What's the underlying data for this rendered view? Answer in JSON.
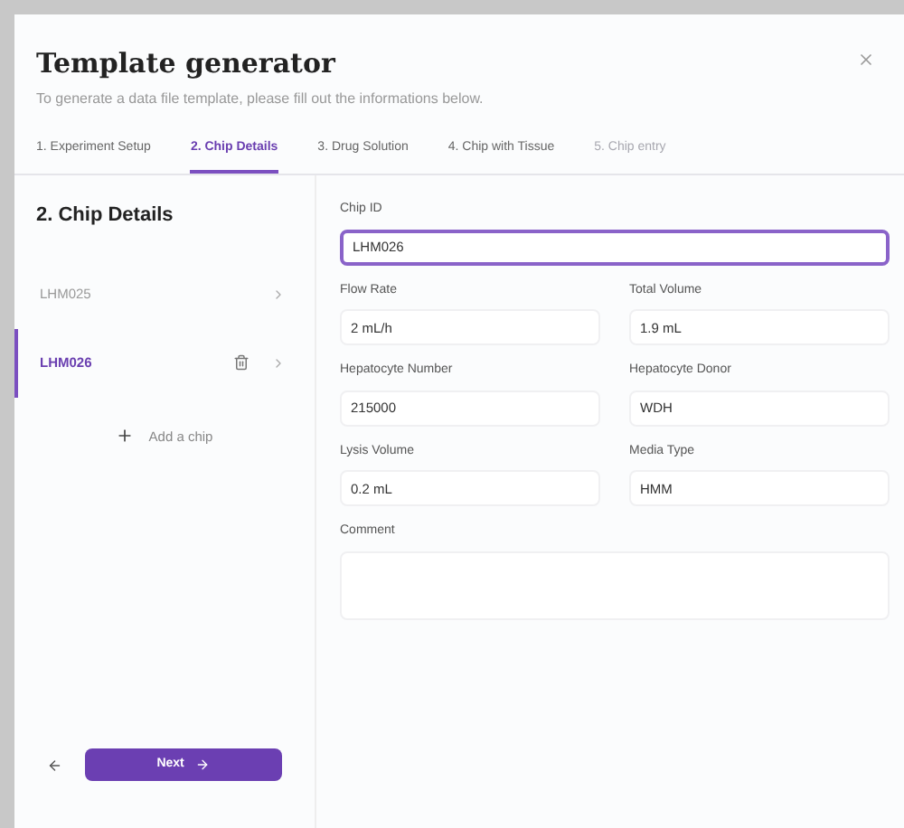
{
  "dialog": {
    "title": "Template generator",
    "subtitle": "To generate a data file template, please fill out the informations below."
  },
  "tabs": [
    {
      "label": "1. Experiment Setup",
      "selected": false,
      "disabled": false
    },
    {
      "label": "2. Chip Details",
      "selected": true,
      "disabled": false
    },
    {
      "label": "3. Drug Solution",
      "selected": false,
      "disabled": false
    },
    {
      "label": "4. Chip with Tissue",
      "selected": false,
      "disabled": false
    },
    {
      "label": "5. Chip entry",
      "selected": false,
      "disabled": true
    }
  ],
  "sidebar": {
    "heading": "2. Chip Details",
    "chips": [
      {
        "name": "LHM025",
        "selected": false
      },
      {
        "name": "LHM026",
        "selected": true
      }
    ],
    "add_label": "Add a chip"
  },
  "fields": [
    {
      "label": "Chip ID",
      "value": "LHM026",
      "kind": "wide",
      "focused": true
    },
    {
      "label": "Flow Rate",
      "value": "2 mL/h",
      "kind": "half",
      "focused": false
    },
    {
      "label": "Total Volume",
      "value": "1.9 mL",
      "kind": "half",
      "focused": false
    },
    {
      "label": "Hepatocyte Number",
      "value": "215000",
      "kind": "half",
      "focused": false
    },
    {
      "label": "Hepatocyte Donor",
      "value": "WDH",
      "kind": "half",
      "focused": false
    },
    {
      "label": "Lysis Volume",
      "value": "0.2 mL",
      "kind": "half",
      "focused": false
    },
    {
      "label": "Media Type",
      "value": "HMM",
      "kind": "half",
      "focused": false
    },
    {
      "label": "Comment",
      "kind": "textarea",
      "focused": false
    }
  ],
  "footer": {
    "next": "Next"
  }
}
